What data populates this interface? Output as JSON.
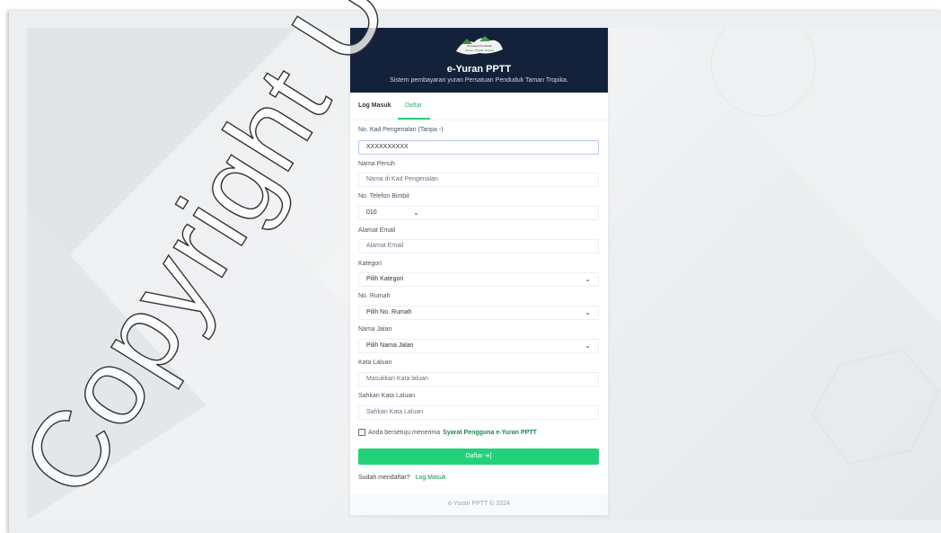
{
  "header": {
    "title": "e-Yuran PPTT",
    "subtitle": "Sistem pembayaran yuran Persatuan Penduduk Taman Tropika.",
    "logo_text": "Persatuan Penduduk Taman Tropika Kajang"
  },
  "tabs": {
    "login": "Log Masuk",
    "register": "Daftar"
  },
  "form": {
    "ic_label": "No. Kad Pengenalan (Tanpa -)",
    "ic_value": "XXXXXXXXXX",
    "name_label": "Nama Penuh",
    "name_placeholder": "Nama di Kad Pengenalan",
    "phone_label": "No. Telefon Bimbit",
    "phone_prefix": "010",
    "email_label": "Alamat Email",
    "email_placeholder": "Alamat Email",
    "category_label": "Kategori",
    "category_value": "Pilih Kategori",
    "house_label": "No. Rumah",
    "house_value": "Pilih No. Rumah",
    "street_label": "Nama Jalan",
    "street_value": "Pilih Nama Jalan",
    "password_label": "Kata Laluan",
    "password_placeholder": "Masukkan Kata laluan",
    "confirm_label": "Sahkan Kata Laluan",
    "confirm_placeholder": "Sahkan Kata Laluan",
    "agree_text": "Anda bersetuju menerima",
    "terms_link": "Syarat Pengguna e-Yuran PPTT",
    "submit_label": "Daftar ➜]",
    "already_text": "Sudah mendaftar?",
    "login_link": "Log Masuk"
  },
  "footer": {
    "text": "e-Yuran PPTT © 2024"
  },
  "watermark": {
    "text": "Copyright UKM"
  },
  "colors": {
    "header_bg": "#14213a",
    "accent": "#22d27a",
    "link": "#1a8a4a"
  }
}
